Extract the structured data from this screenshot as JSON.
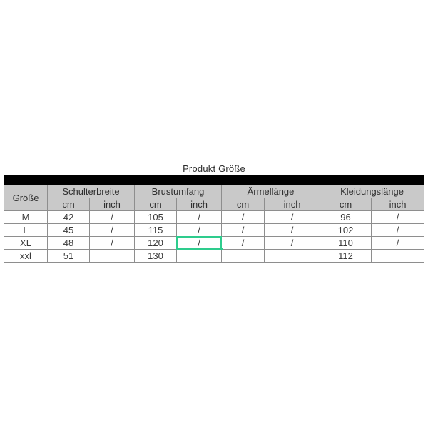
{
  "chart": {
    "title": "Produkt Größe",
    "accent_color": "#2ecc8d",
    "header_bg": "#c9c9c9",
    "bar_color": "#000000",
    "size_header": "Größe",
    "groups": [
      {
        "label": "Schulterbreite"
      },
      {
        "label": "Brustumfang"
      },
      {
        "label": "Ärmellänge"
      },
      {
        "label": "Kleidungslänge"
      }
    ],
    "units": [
      "cm",
      "inch",
      "cm",
      "inch",
      "cm",
      "inch",
      "cm",
      "inch"
    ],
    "rows": [
      {
        "size": "M",
        "cells": [
          "42",
          "/",
          "105",
          "/",
          "/",
          "/",
          "96",
          "/"
        ]
      },
      {
        "size": "L",
        "cells": [
          "45",
          "/",
          "115",
          "/",
          "/",
          "/",
          "102",
          "/"
        ]
      },
      {
        "size": "XL",
        "cells": [
          "48",
          "/",
          "120",
          "/",
          "/",
          "/",
          "110",
          "/"
        ]
      },
      {
        "size": "xxl",
        "cells": [
          "51",
          "",
          "130",
          "",
          "",
          "",
          "112",
          ""
        ]
      }
    ],
    "selected_cell": {
      "row": 2,
      "col": 3,
      "value": "/"
    }
  },
  "chart_data": {
    "type": "table",
    "title": "Produkt Größe",
    "columns": [
      "Größe",
      "Schulterbreite cm",
      "Schulterbreite inch",
      "Brustumfang cm",
      "Brustumfang inch",
      "Ärmellänge cm",
      "Ärmellänge inch",
      "Kleidungslänge cm",
      "Kleidungslänge inch"
    ],
    "rows": [
      [
        "M",
        "42",
        "/",
        "105",
        "/",
        "/",
        "/",
        "96",
        "/"
      ],
      [
        "L",
        "45",
        "/",
        "115",
        "/",
        "/",
        "/",
        "102",
        "/"
      ],
      [
        "XL",
        "48",
        "/",
        "120",
        "/",
        "/",
        "/",
        "110",
        "/"
      ],
      [
        "xxl",
        "51",
        "",
        "130",
        "",
        "",
        "",
        "112",
        ""
      ]
    ]
  }
}
